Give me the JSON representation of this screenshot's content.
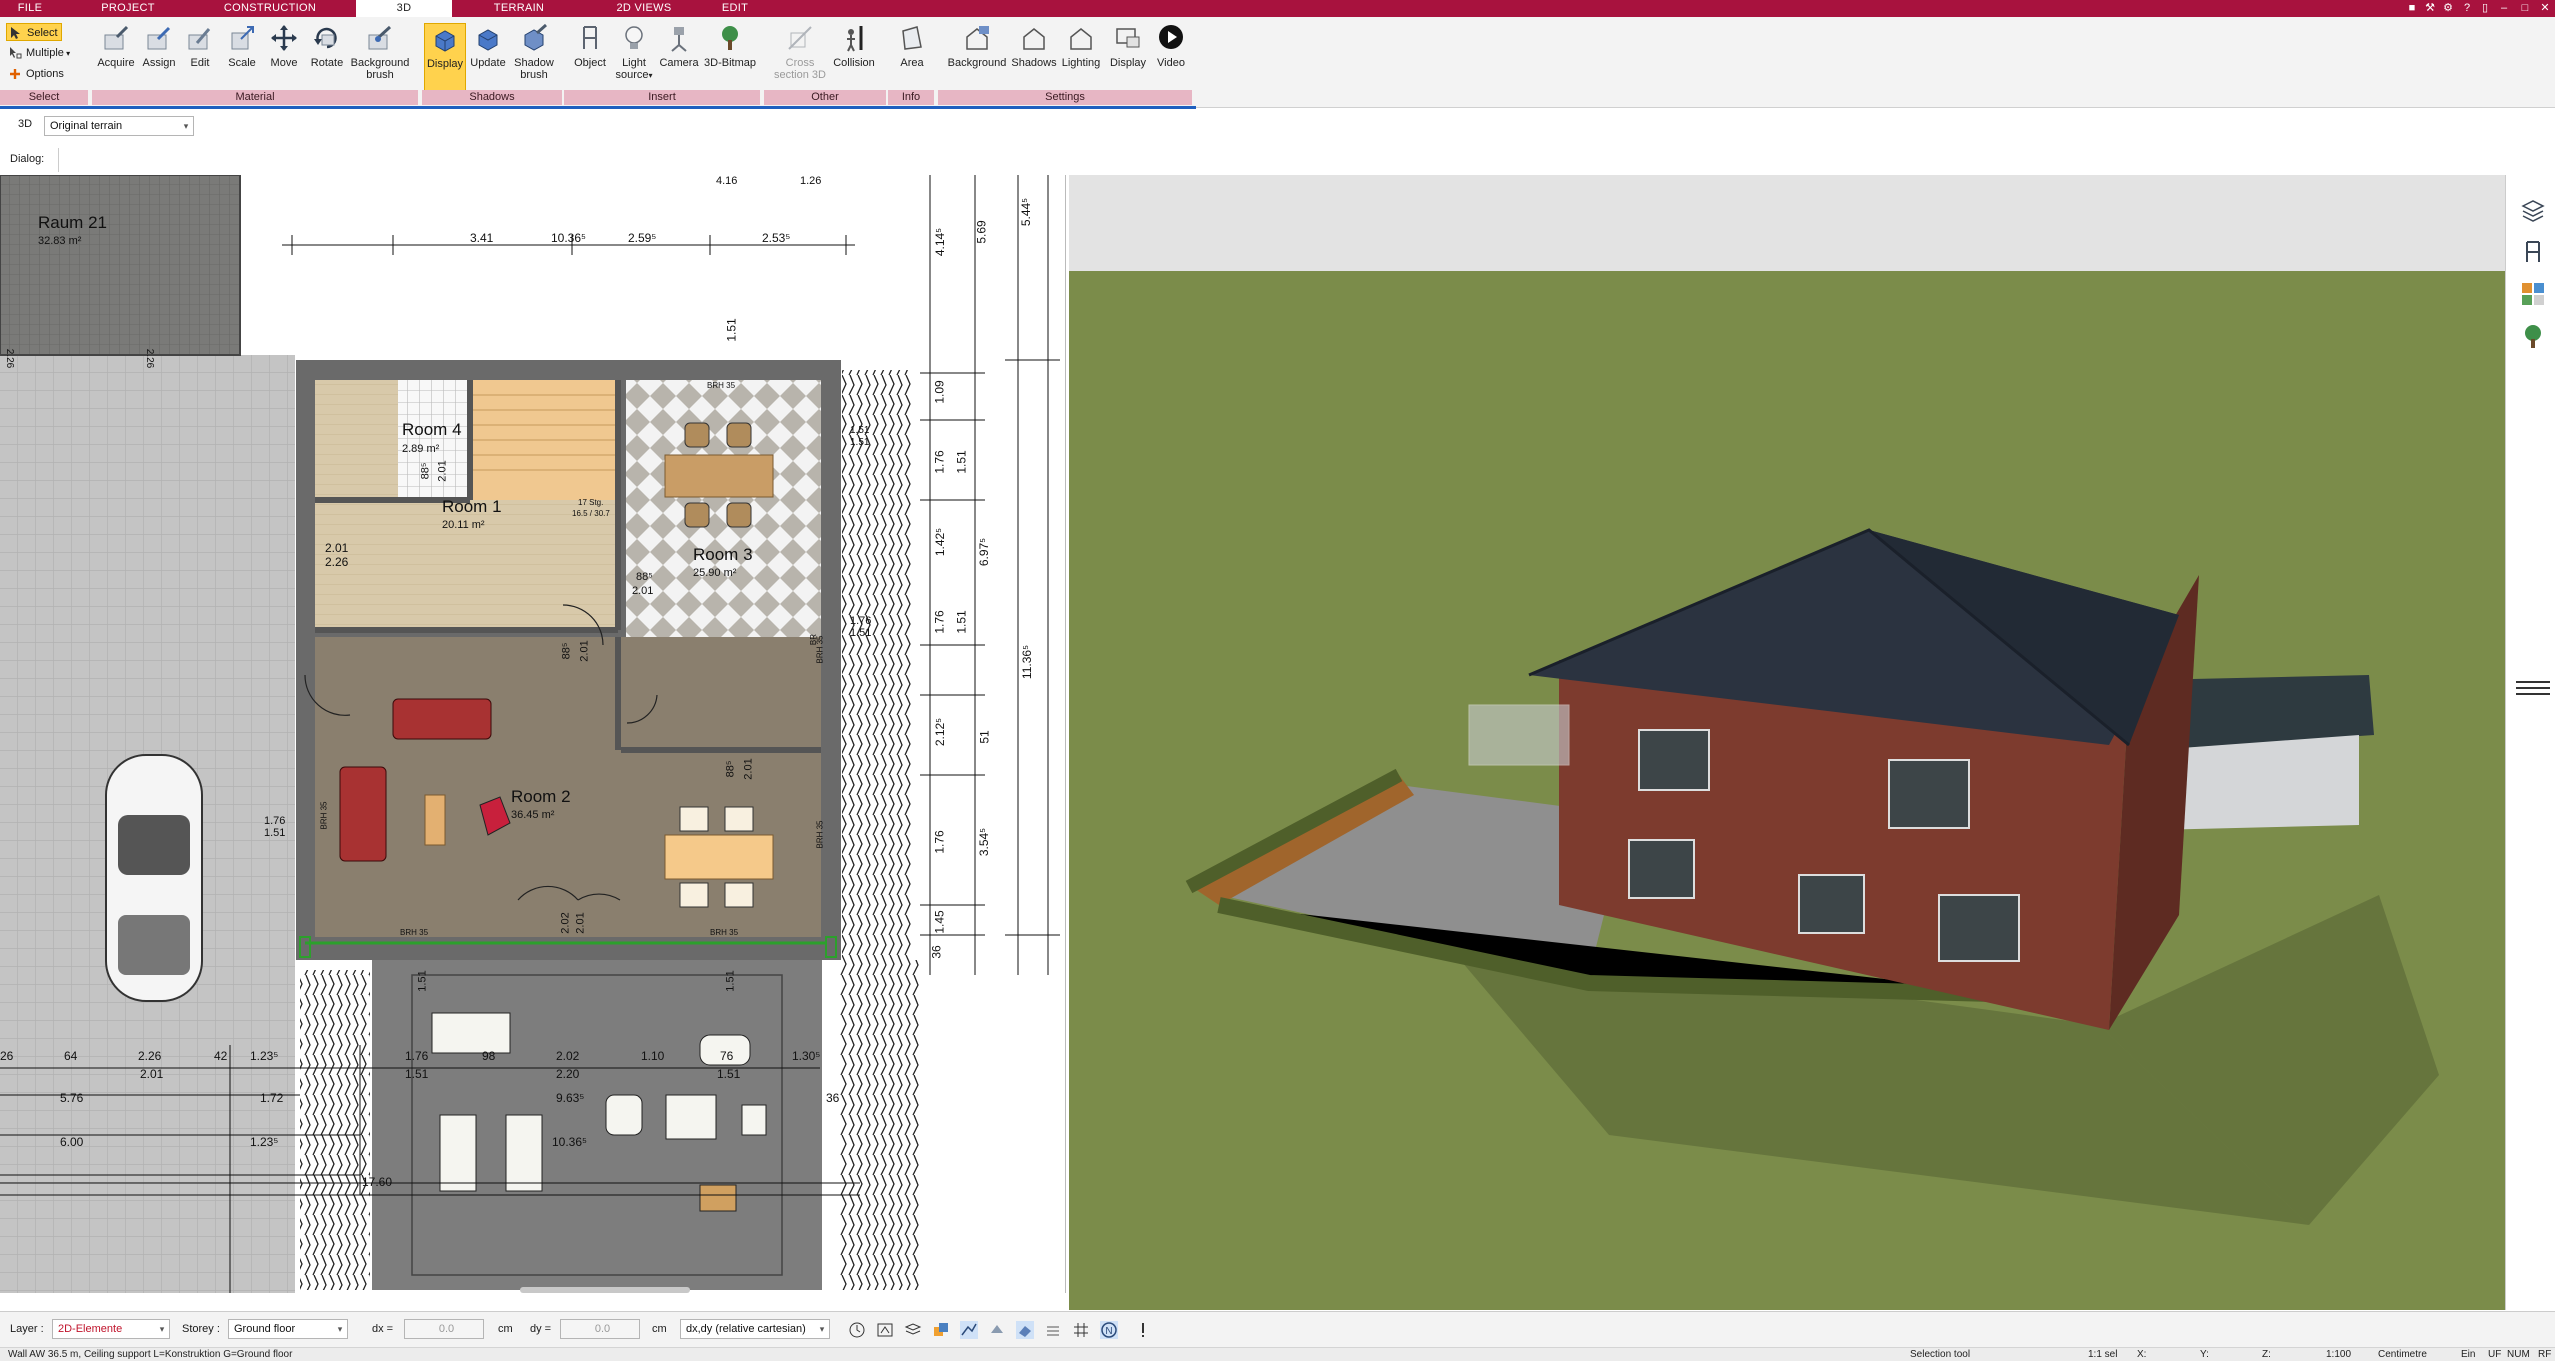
{
  "menu": {
    "tabs": [
      {
        "label": "FILE"
      },
      {
        "label": "PROJECT"
      },
      {
        "label": "CONSTRUCTION"
      },
      {
        "label": "3D"
      },
      {
        "label": "TERRAIN"
      },
      {
        "label": "2D VIEWS"
      },
      {
        "label": "EDIT"
      }
    ],
    "active_tab": "3D"
  },
  "ribbon": {
    "select": {
      "select_label": "Select",
      "multiple_label": "Multiple",
      "options_label": "Options",
      "group_label": "Select"
    },
    "material": {
      "buttons": [
        {
          "label": "Acquire"
        },
        {
          "label": "Assign"
        },
        {
          "label": "Edit"
        },
        {
          "label": "Scale"
        },
        {
          "label": "Move"
        },
        {
          "label": "Rotate"
        },
        {
          "label1": "Background",
          "label2": "brush"
        }
      ],
      "group_label": "Material"
    },
    "shadows": {
      "buttons": [
        {
          "label": "Display"
        },
        {
          "label": "Update"
        },
        {
          "label1": "Shadow",
          "label2": "brush"
        }
      ],
      "group_label": "Shadows"
    },
    "insert": {
      "buttons": [
        {
          "label": "Object"
        },
        {
          "label1": "Light",
          "label2": "source"
        },
        {
          "label": "Camera"
        },
        {
          "label": "3D-Bitmap"
        }
      ],
      "group_label": "Insert"
    },
    "other": {
      "buttons": [
        {
          "label1": "Cross",
          "label2": "section 3D"
        },
        {
          "label": "Collision"
        }
      ],
      "group_label": "Other"
    },
    "info": {
      "buttons": [
        {
          "label": "Area"
        }
      ],
      "group_label": "Info"
    },
    "settings": {
      "buttons": [
        {
          "label": "Background"
        },
        {
          "label": "Shadows"
        },
        {
          "label": "Lighting"
        },
        {
          "label": "Display"
        },
        {
          "label": "Video"
        }
      ],
      "group_label": "Settings"
    }
  },
  "toolbar2": {
    "mode": "3D",
    "terrain_select": "Original terrain"
  },
  "dialog_bar": {
    "label": "Dialog:"
  },
  "plan": {
    "rooms": [
      {
        "name": "Raum 21",
        "area": "32.83 m²"
      },
      {
        "name": "Room 4",
        "area": "2.89 m²"
      },
      {
        "name": "Room 1",
        "area": "20.11 m²"
      },
      {
        "name": "Room 3",
        "area": "25.90 m²"
      },
      {
        "name": "Room 2",
        "area": "36.45 m²"
      }
    ],
    "dims_top": [
      "3.41",
      "10.36⁵",
      "2.59⁵",
      "2.53⁵",
      "4.16",
      "1.26"
    ],
    "dims_right": [
      "5.69",
      "5.44⁵",
      "4.14⁵",
      "1.09",
      "1.76",
      "1.51",
      "1.42⁵",
      "6.97⁵",
      "1.76",
      "1.51",
      "11.36⁵",
      "2.12⁵",
      "1.76",
      "3.54⁵",
      "1.45",
      "36",
      "51",
      "1.51"
    ],
    "dims_bottom": [
      "26",
      "64",
      "2.26",
      "42",
      "1.23⁵",
      "1.76",
      "98",
      "2.02",
      "1.10",
      "76",
      "1.30⁵",
      "2.01",
      "1.51",
      "2.20",
      "1.51",
      "5.76",
      "1.72",
      "9.63⁵",
      "36",
      "6.00",
      "1.23⁵",
      "10.36⁵",
      "17.60"
    ],
    "misc_labels": [
      "BRH 35",
      "BRH 35",
      "BRH 35",
      "BRH 35",
      "BRH 35",
      "BRH 35",
      "2.01",
      "2.26",
      "88⁵",
      "2.01",
      "88⁵",
      "2.01",
      "88⁵",
      "2.01",
      "88⁵",
      "2.01",
      "17 Stg.",
      "16.5 / 30.7",
      "1.76",
      "1.51",
      "2.02",
      "2.01",
      "1.76",
      "1.51",
      "1.51",
      "1.51",
      "2.26",
      "2.26",
      "1.51",
      "1.51",
      "BR"
    ]
  },
  "status": {
    "layer_label": "Layer :",
    "layer_value": "2D-Elemente",
    "storey_label": "Storey :",
    "storey_value": "Ground floor",
    "dx_label": "dx =",
    "dx_value": "0.0",
    "dy_label": "dy =",
    "dy_value": "0.0",
    "unit": "cm",
    "coord_mode": "dx,dy (relative cartesian)"
  },
  "footer": {
    "message": "Wall AW 36.5 m, Ceiling support L=Konstruktion G=Ground floor",
    "tool": "Selection tool",
    "sel": "1:1 sel",
    "x": "X:",
    "y": "Y:",
    "z": "Z:",
    "scale": "1:100",
    "units": "Centimetre",
    "ein": "Ein",
    "uf": "UF",
    "num": "NUM",
    "rf": "RF"
  },
  "colors": {
    "menu_bg": "#a8123e",
    "group_label_bg": "#e7b6c4",
    "active_btn": "#ffd24d",
    "grass": "#7a8a4a",
    "roof": "#2b3340",
    "brick": "#7a3a2e"
  }
}
